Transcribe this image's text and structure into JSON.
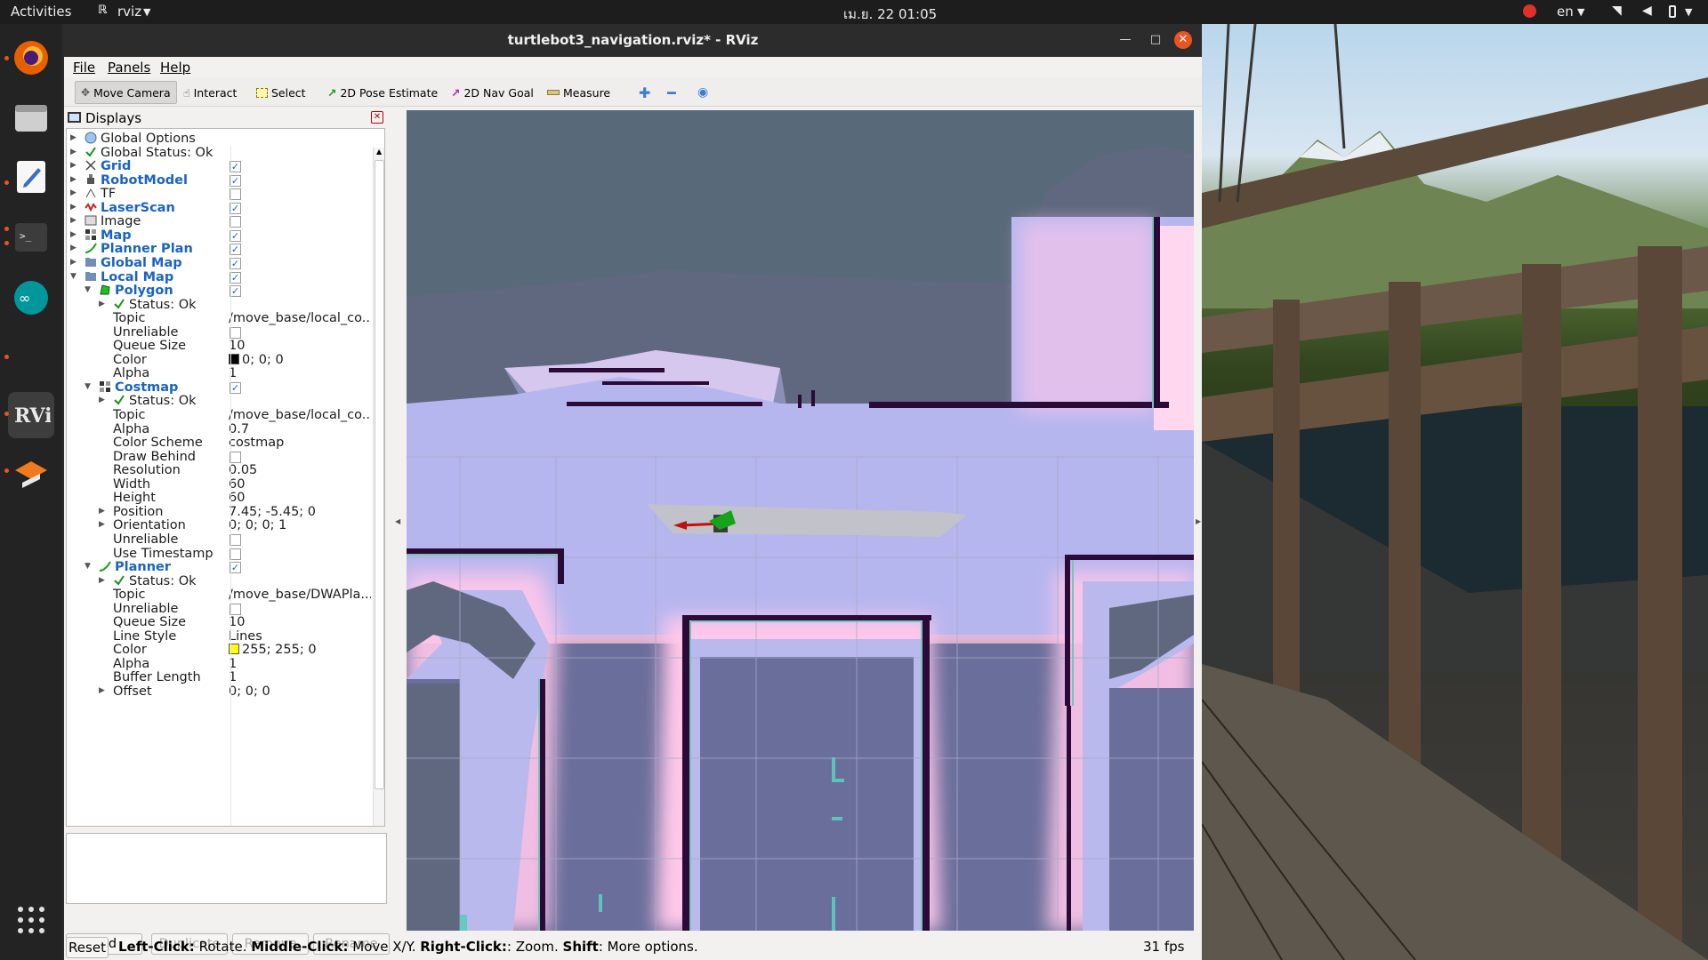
{
  "topbar": {
    "activities": "Activities",
    "app": "rviz",
    "clock": "เม.ย. 22  01:05",
    "lang": "en"
  },
  "window": {
    "title": "turtlebot3_navigation.rviz* - RViz"
  },
  "menu": [
    "File",
    "Panels",
    "Help"
  ],
  "toolbar": {
    "move_camera": "Move Camera",
    "interact": "Interact",
    "select": "Select",
    "pose": "2D Pose Estimate",
    "nav": "2D Nav Goal",
    "measure": "Measure"
  },
  "displays": {
    "title": "Displays",
    "rows": [
      {
        "label": "Global Options",
        "ind": 0,
        "arrow": "right",
        "icon": "globe-icon"
      },
      {
        "label": "Global Status: Ok",
        "ind": 0,
        "arrow": "right",
        "icon": "check-icon"
      },
      {
        "label": "Grid",
        "ind": 0,
        "arrow": "right",
        "icon": "grid-icon",
        "bold": true,
        "check": true
      },
      {
        "label": "RobotModel",
        "ind": 0,
        "arrow": "right",
        "icon": "robot-icon",
        "bold": true,
        "check": true
      },
      {
        "label": "TF",
        "ind": 0,
        "arrow": "right",
        "icon": "tf-icon",
        "check": false
      },
      {
        "label": "LaserScan",
        "ind": 0,
        "arrow": "right",
        "icon": "laser-icon",
        "bold": true,
        "check": true
      },
      {
        "label": "Image",
        "ind": 0,
        "arrow": "right",
        "icon": "image-icon",
        "check": false
      },
      {
        "label": "Map",
        "ind": 0,
        "arrow": "right",
        "icon": "map-icon",
        "bold": true,
        "check": true
      },
      {
        "label": "Planner Plan",
        "ind": 0,
        "arrow": "right",
        "icon": "path-icon",
        "bold": true,
        "check": true
      },
      {
        "label": "Global Map",
        "ind": 0,
        "arrow": "right",
        "icon": "folder-icon",
        "bold": true,
        "check": true
      },
      {
        "label": "Local Map",
        "ind": 0,
        "arrow": "down",
        "icon": "folder-icon",
        "bold": true,
        "check": true
      },
      {
        "label": "Polygon",
        "ind": 1,
        "arrow": "down",
        "icon": "polygon-icon",
        "bold": true,
        "check": true
      },
      {
        "label": "Status: Ok",
        "ind": 2,
        "arrow": "right",
        "icon": "check-icon"
      },
      {
        "label": "Topic",
        "ind": 2,
        "value": "/move_base/local_co..."
      },
      {
        "label": "Unreliable",
        "ind": 2,
        "check": false
      },
      {
        "label": "Queue Size",
        "ind": 2,
        "value": "10"
      },
      {
        "label": "Color",
        "ind": 2,
        "value": "0; 0; 0",
        "swatch": "#000000"
      },
      {
        "label": "Alpha",
        "ind": 2,
        "value": "1"
      },
      {
        "label": "Costmap",
        "ind": 1,
        "arrow": "down",
        "icon": "map-icon",
        "bold": true,
        "check": true
      },
      {
        "label": "Status: Ok",
        "ind": 2,
        "arrow": "right",
        "icon": "check-icon"
      },
      {
        "label": "Topic",
        "ind": 2,
        "value": "/move_base/local_co..."
      },
      {
        "label": "Alpha",
        "ind": 2,
        "value": "0.7"
      },
      {
        "label": "Color Scheme",
        "ind": 2,
        "value": "costmap"
      },
      {
        "label": "Draw Behind",
        "ind": 2,
        "check": false
      },
      {
        "label": "Resolution",
        "ind": 2,
        "value": "0.05"
      },
      {
        "label": "Width",
        "ind": 2,
        "value": "60"
      },
      {
        "label": "Height",
        "ind": 2,
        "value": "60"
      },
      {
        "label": "Position",
        "ind": 2,
        "arrow": "right",
        "value": "7.45; -5.45; 0"
      },
      {
        "label": "Orientation",
        "ind": 2,
        "arrow": "right",
        "value": "0; 0; 0; 1"
      },
      {
        "label": "Unreliable",
        "ind": 2,
        "check": false
      },
      {
        "label": "Use Timestamp",
        "ind": 2,
        "check": false
      },
      {
        "label": "Planner",
        "ind": 1,
        "arrow": "down",
        "icon": "path-icon",
        "bold": true,
        "check": true
      },
      {
        "label": "Status: Ok",
        "ind": 2,
        "arrow": "right",
        "icon": "check-icon"
      },
      {
        "label": "Topic",
        "ind": 2,
        "value": "/move_base/DWAPla..."
      },
      {
        "label": "Unreliable",
        "ind": 2,
        "check": false
      },
      {
        "label": "Queue Size",
        "ind": 2,
        "value": "10"
      },
      {
        "label": "Line Style",
        "ind": 2,
        "value": "Lines"
      },
      {
        "label": "Color",
        "ind": 2,
        "value": "255; 255; 0",
        "swatch": "#ffff00"
      },
      {
        "label": "Alpha",
        "ind": 2,
        "value": "1"
      },
      {
        "label": "Buffer Length",
        "ind": 2,
        "value": "1"
      },
      {
        "label": "Offset",
        "ind": 2,
        "arrow": "right",
        "value": "0; 0; 0"
      }
    ]
  },
  "buttons": {
    "add": "Add",
    "duplicate": "Duplicate",
    "remove": "Remove",
    "rename": "Rename"
  },
  "status": {
    "reset": "Reset",
    "k1": "Left-Click:",
    "t1": " Rotate. ",
    "k2": "Middle-Click:",
    "t2": " Move X/Y. ",
    "k3": "Right-Click:",
    "t3": ": Zoom. ",
    "k4": "Shift",
    "t4": ": More options.",
    "fps": "31 fps"
  },
  "colors": {
    "costmap_free": "#b5b5ee",
    "costmap_unknown": "#5f687f",
    "wall": "#2a0a36",
    "inflation": "#ffc7ea",
    "grid": "#a0a0a0"
  }
}
